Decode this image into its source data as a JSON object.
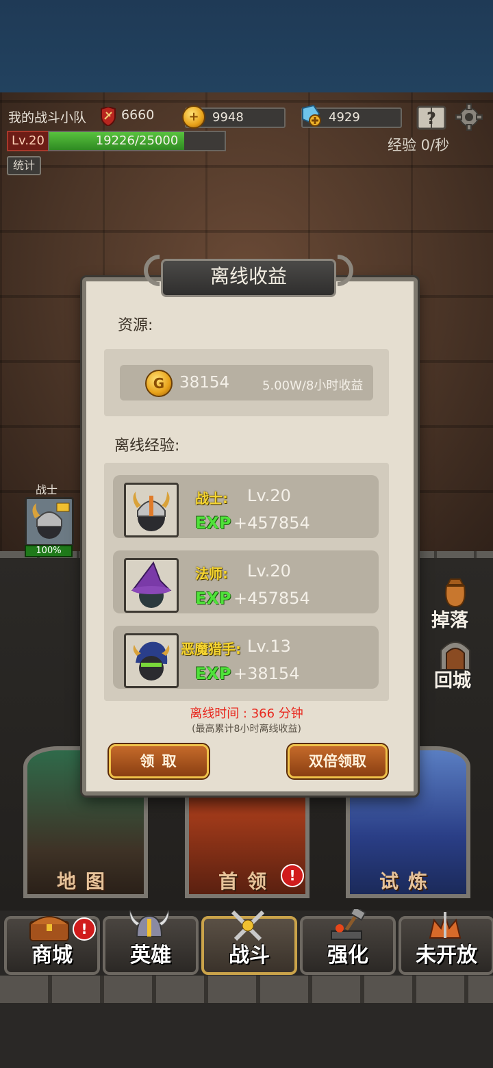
{
  "hud": {
    "team_name": "我的战斗小队",
    "power": "6660",
    "gold": "9948",
    "gems": "4929",
    "level": "Lv.20",
    "exp_progress": "19226/25000",
    "exp_fraction": 0.769,
    "exp_rate": "经验 0/秒",
    "stats_button": "统计"
  },
  "unit": {
    "name": "战士",
    "hp_percent": "100%"
  },
  "dialog": {
    "title": "离线收益",
    "resources_label": "资源:",
    "gold_amount": "38154",
    "gold_rate": "5.00W/8小时收益",
    "exp_label": "离线经验:",
    "heroes": [
      {
        "name": "战士:",
        "level": "Lv.20",
        "exp_tag": "EXP",
        "exp": "+457854"
      },
      {
        "name": "法师:",
        "level": "Lv.20",
        "exp_tag": "EXP",
        "exp": "+457854"
      },
      {
        "name": "恶魔猎手:",
        "level": "Lv.13",
        "exp_tag": "EXP",
        "exp": "+38154"
      }
    ],
    "offline_time": "离线时间 : 366 分钟",
    "offline_note": "(最高累计8小时离线收益)",
    "claim_button": "领 取",
    "double_claim_button": "双倍领取"
  },
  "side": {
    "drops_label": "掉落",
    "return_label": "回城"
  },
  "stages": [
    {
      "label": "地图",
      "badge": ""
    },
    {
      "label": "首领",
      "badge": "!"
    },
    {
      "label": "试炼",
      "badge": ""
    }
  ],
  "nav": [
    {
      "label": "商城",
      "badge": "!"
    },
    {
      "label": "英雄",
      "badge": ""
    },
    {
      "label": "战斗",
      "badge": ""
    },
    {
      "label": "强化",
      "badge": ""
    },
    {
      "label": "未开放",
      "badge": ""
    }
  ]
}
